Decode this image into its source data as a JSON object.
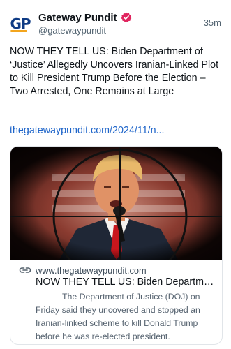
{
  "account": {
    "display_name": "Gateway Pundit",
    "handle": "@gatewaypundit",
    "avatar_text": "GP",
    "timestamp": "35m"
  },
  "post": {
    "text": "NOW THEY TELL US: Biden Department of ‘Justice’ Allegedly Uncovers Iranian-Linked Plot to Kill President Trump Before the Election – Two Arrested, One Remains at Large",
    "link_text": "thegatewaypundit.com/2024/11/n..."
  },
  "card": {
    "image_icon": "crosshair-scope-image",
    "link_icon": "link-icon",
    "domain": "www.thegatewaypundit.com",
    "title": "NOW THEY TELL US: Biden Department of ‘Justice’ Allegedly Uncovers Iranian-Linked Plot",
    "description": "The Department of Justice (DOJ) on Friday said they uncovered and stopped an Iranian-linked scheme to kill Donald Trump before he was re-elected president."
  },
  "colors": {
    "link": "#1d64c9",
    "verified_badge": "#e0245e",
    "avatar_text": "#0e3a84",
    "avatar_accent": "#f3a51d",
    "secondary_text": "#536471"
  }
}
